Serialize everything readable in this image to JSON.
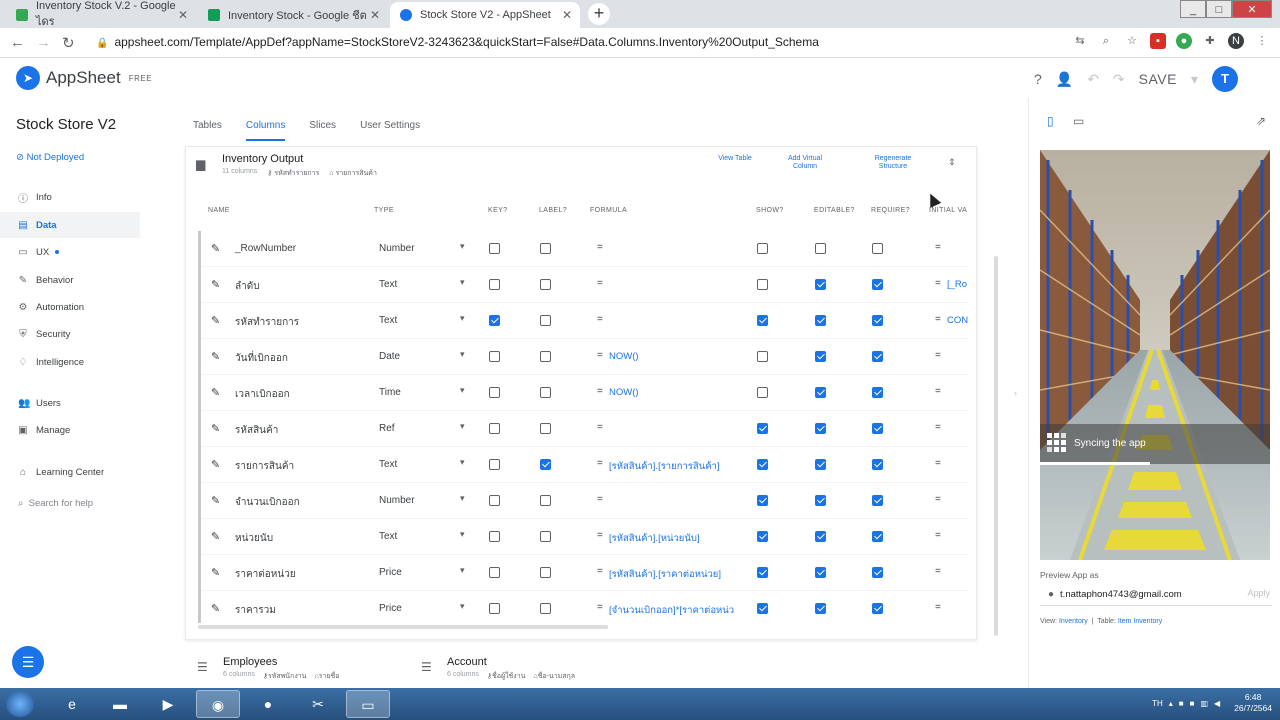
{
  "browser": {
    "tabs": [
      {
        "title": "Inventory Stock V.2 - Google ไดร",
        "icon_color": "#34a853"
      },
      {
        "title": "Inventory Stock - Google ชีต",
        "icon_color": "#0f9d58"
      },
      {
        "title": "Stock Store V2 - AppSheet",
        "icon_color": "#1a73e8"
      }
    ],
    "new_tab": "+",
    "url": "appsheet.com/Template/AppDef?appName=StockStoreV2-3243623&quickStart=False#Data.Columns.Inventory%20Output_Schema",
    "profile_initial": "N"
  },
  "header": {
    "brand": "AppSheet",
    "plan": "FREE",
    "save_label": "SAVE",
    "user_initial": "T"
  },
  "sidebar": {
    "app_title": "Stock Store V2",
    "deploy_status": "Not Deployed",
    "items": [
      {
        "label": "Info",
        "icon": "info-icon"
      },
      {
        "label": "Data",
        "icon": "data-icon"
      },
      {
        "label": "UX",
        "icon": "ux-icon"
      },
      {
        "label": "Behavior",
        "icon": "behavior-icon"
      },
      {
        "label": "Automation",
        "icon": "automation-icon"
      },
      {
        "label": "Security",
        "icon": "security-icon"
      },
      {
        "label": "Intelligence",
        "icon": "intelligence-icon"
      },
      {
        "label": "Users",
        "icon": "users-icon"
      },
      {
        "label": "Manage",
        "icon": "manage-icon"
      },
      {
        "label": "Learning Center",
        "icon": "learning-icon"
      }
    ],
    "search_placeholder": "Search for help"
  },
  "main": {
    "tabs": [
      "Tables",
      "Columns",
      "Slices",
      "User Settings"
    ],
    "active_tab": "Columns",
    "table": {
      "name": "Inventory Output",
      "column_count": "11 columns",
      "key_label": "รหัสทำรายการ",
      "label_label": "รายการสินค้า",
      "actions": [
        "View Table",
        "Add Virtual Column",
        "Regenerate Structure"
      ],
      "headers": [
        "NAME",
        "TYPE",
        "KEY?",
        "LABEL?",
        "FORMULA",
        "SHOW?",
        "EDITABLE?",
        "REQUIRE?",
        "INITIAL VA"
      ],
      "rows": [
        {
          "name": "_RowNumber",
          "type": "Number",
          "key": false,
          "label": false,
          "formula": "",
          "show": false,
          "editable": false,
          "require": false,
          "initial": ""
        },
        {
          "name": "ลำดับ",
          "type": "Text",
          "key": false,
          "label": false,
          "formula": "",
          "show": false,
          "editable": true,
          "require": true,
          "initial": "[_Ro"
        },
        {
          "name": "รหัสทำรายการ",
          "type": "Text",
          "key": true,
          "label": false,
          "formula": "",
          "show": true,
          "editable": true,
          "require": true,
          "initial": "CON"
        },
        {
          "name": "วันที่เบิกออก",
          "type": "Date",
          "key": false,
          "label": false,
          "formula": "NOW()",
          "show": false,
          "editable": true,
          "require": true,
          "initial": ""
        },
        {
          "name": "เวลาเบิกออก",
          "type": "Time",
          "key": false,
          "label": false,
          "formula": "NOW()",
          "show": false,
          "editable": true,
          "require": true,
          "initial": ""
        },
        {
          "name": "รหัสสินค้า",
          "type": "Ref",
          "key": false,
          "label": false,
          "formula": "",
          "show": true,
          "editable": true,
          "require": true,
          "initial": ""
        },
        {
          "name": "รายการสินค้า",
          "type": "Text",
          "key": false,
          "label": true,
          "formula": "[รหัสสินค้า].[รายการสินค้า]",
          "show": true,
          "editable": true,
          "require": true,
          "initial": ""
        },
        {
          "name": "จำนวนเบิกออก",
          "type": "Number",
          "key": false,
          "label": false,
          "formula": "",
          "show": true,
          "editable": true,
          "require": true,
          "initial": ""
        },
        {
          "name": "หน่วยนับ",
          "type": "Text",
          "key": false,
          "label": false,
          "formula": "[รหัสสินค้า].[หน่วยนับ]",
          "show": true,
          "editable": true,
          "require": true,
          "initial": ""
        },
        {
          "name": "ราคาต่อหน่วย",
          "type": "Price",
          "key": false,
          "label": false,
          "formula": "[รหัสสินค้า].[ราคาต่อหน่วย]",
          "show": true,
          "editable": true,
          "require": true,
          "initial": ""
        },
        {
          "name": "ราคารวม",
          "type": "Price",
          "key": false,
          "label": false,
          "formula": "[จำนวนเบิกออก]*[ราคาต่อหน่ว",
          "show": true,
          "editable": true,
          "require": true,
          "initial": ""
        }
      ]
    },
    "other_tables": [
      {
        "name": "Employees",
        "count": "6 columns",
        "key": "รหัสพนักงาน",
        "label": "รายชื่อ"
      },
      {
        "name": "Account",
        "count": "6 columns",
        "key": "ชื่อผู้ใช้งาน",
        "label": "ชื่อ-นามสกุล"
      }
    ]
  },
  "preview": {
    "sync_text": "Syncing the app",
    "preview_as_label": "Preview App as",
    "email": "t.nattaphon4743@gmail.com",
    "apply_label": "Apply",
    "view_label": "View",
    "view_value": "Inventory",
    "table_label": "Table",
    "table_value": "Item Inventory"
  },
  "taskbar": {
    "lang": "TH",
    "time": "6:48",
    "date": "26/7/2564"
  }
}
